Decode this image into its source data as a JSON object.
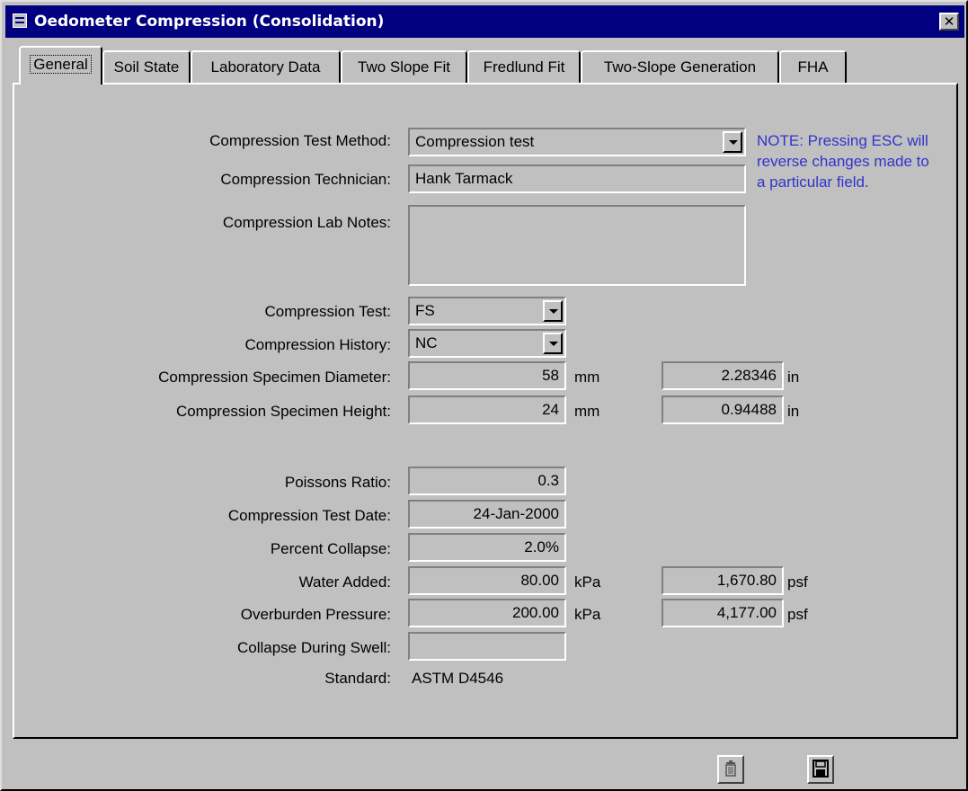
{
  "window": {
    "title": "Oedometer Compression (Consolidation)",
    "close_glyph": "✕"
  },
  "tabs": [
    {
      "label": "General",
      "active": true
    },
    {
      "label": "Soil State"
    },
    {
      "label": "Laboratory Data"
    },
    {
      "label": "Two Slope Fit"
    },
    {
      "label": "Fredlund Fit"
    },
    {
      "label": "Two-Slope Generation"
    },
    {
      "label": "FHA"
    }
  ],
  "general": {
    "method": {
      "label": "Compression Test Method:",
      "value": "Compression test"
    },
    "technician": {
      "label": "Compression Technician:",
      "value": "Hank Tarmack"
    },
    "notes": {
      "label": "Compression Lab Notes:",
      "value": ""
    },
    "note_text": "NOTE: Pressing ESC will reverse changes made to a particular field.",
    "test": {
      "label": "Compression Test:",
      "value": "FS"
    },
    "history": {
      "label": "Compression History:",
      "value": "NC"
    },
    "diameter": {
      "label": "Compression Specimen Diameter:",
      "value": "58",
      "unit": "mm",
      "converted": "2.28346",
      "converted_unit": "in"
    },
    "height": {
      "label": "Compression Specimen Height:",
      "value": "24",
      "unit": "mm",
      "converted": "0.94488",
      "converted_unit": "in"
    },
    "poisson": {
      "label": "Poissons Ratio:",
      "value": "0.3"
    },
    "date": {
      "label": "Compression Test Date:",
      "value": "24-Jan-2000"
    },
    "collapse": {
      "label": "Percent Collapse:",
      "value": "2.0%"
    },
    "water": {
      "label": "Water Added:",
      "value": "80.00",
      "unit": "kPa",
      "converted": "1,670.80",
      "converted_unit": "psf"
    },
    "overburden": {
      "label": "Overburden Pressure:",
      "value": "200.00",
      "unit": "kPa",
      "converted": "4,177.00",
      "converted_unit": "psf"
    },
    "swell": {
      "label": "Collapse During Swell:",
      "value": ""
    },
    "standard": {
      "label": "Standard:",
      "value": "ASTM D4546"
    }
  },
  "toolbar": {
    "delete_icon": "trash-icon",
    "save_icon": "floppy-disk-icon"
  }
}
